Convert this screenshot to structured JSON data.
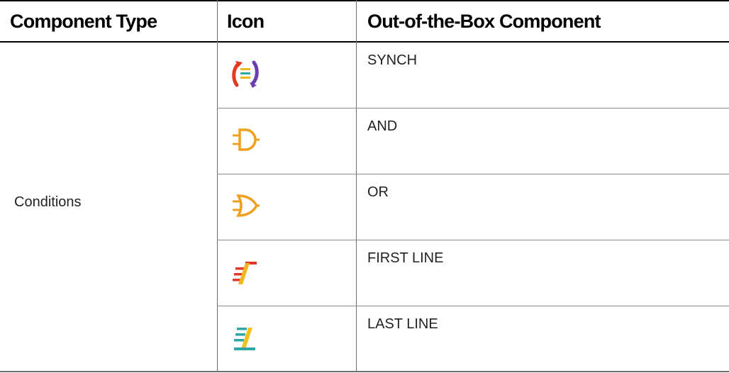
{
  "header": {
    "component_type": "Component Type",
    "icon": "Icon",
    "out_of_box": "Out-of-the-Box Component"
  },
  "group": {
    "type": "Conditions"
  },
  "rows": [
    {
      "name": "SYNCH",
      "icon": "synch-icon"
    },
    {
      "name": "AND",
      "icon": "and-gate-icon"
    },
    {
      "name": "OR",
      "icon": "or-gate-icon"
    },
    {
      "name": "FIRST LINE",
      "icon": "first-line-icon"
    },
    {
      "name": "LAST LINE",
      "icon": "last-line-icon"
    }
  ],
  "colors": {
    "gate_orange": "#f0a020",
    "synch_red": "#e23b1e",
    "synch_purple": "#6b3fb0",
    "first_red": "#e2382a",
    "first_yellow": "#f3b71e",
    "last_teal": "#2fa7a7",
    "last_yellow": "#f0c21b"
  }
}
